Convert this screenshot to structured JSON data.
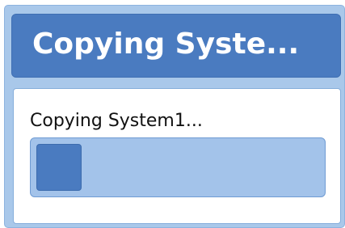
{
  "dialog": {
    "title": "Copying Syste...",
    "status_text": "Copying System1...",
    "progress": 0.16
  },
  "colors": {
    "frame": "#a9c8ea",
    "title_bar": "#4a7bc0",
    "content_bg": "#ffffff",
    "progress_track": "#a3c3ea",
    "progress_fill": "#4a7bc0"
  }
}
